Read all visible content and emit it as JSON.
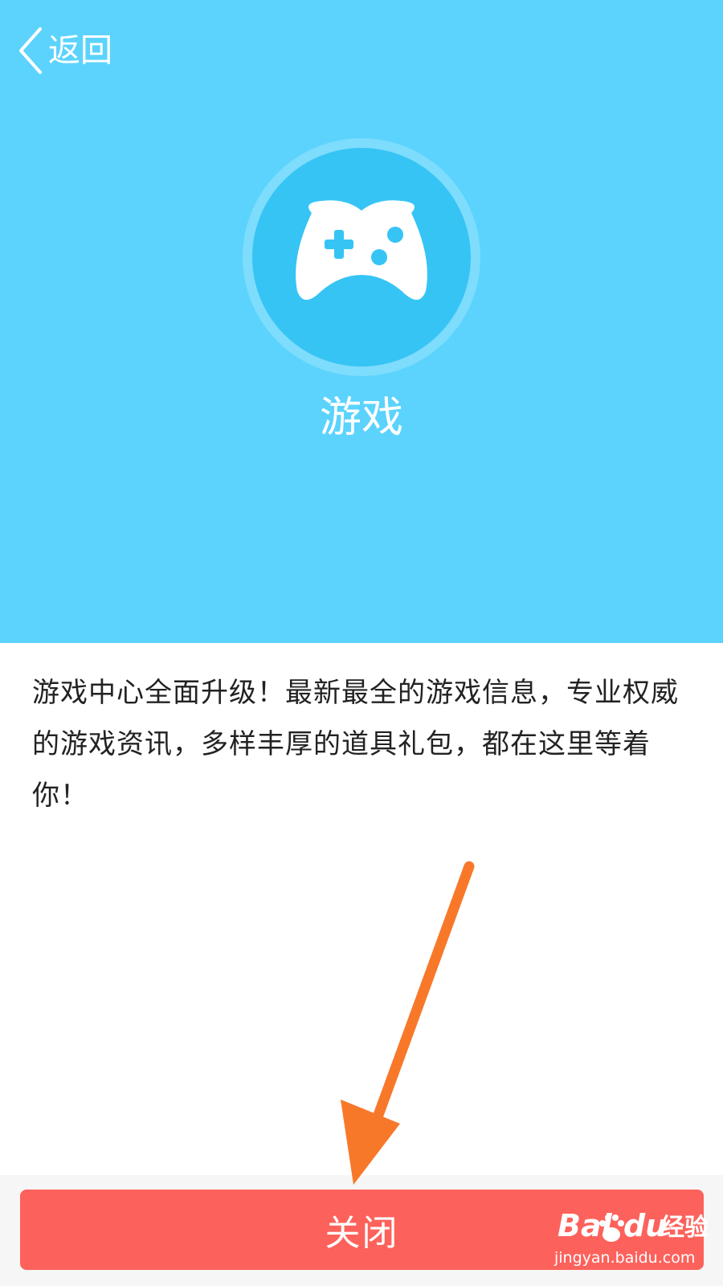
{
  "nav": {
    "back_label": "返回",
    "back_icon": "chevron-left-icon"
  },
  "feature": {
    "icon": "gamepad-icon",
    "title": "游戏",
    "description": "游戏中心全面升级！最新最全的游戏信息，专业权威的游戏资讯，多样丰厚的道具礼包，都在这里等着你！"
  },
  "footer": {
    "close_label": "关闭"
  },
  "annotation": {
    "arrow_icon": "orange-arrow-icon",
    "color": "#f8782a"
  },
  "watermark": {
    "brand_bai": "Bai",
    "brand_du": "du",
    "brand_cn": "经验",
    "url": "jingyan.baidu.com"
  },
  "colors": {
    "hero_bg": "#5bd3fd",
    "icon_circle": "#36c4f5",
    "icon_ring": "#7edcfd",
    "close_button_bg": "#fc625b",
    "footer_bg": "#f6f6f6"
  }
}
